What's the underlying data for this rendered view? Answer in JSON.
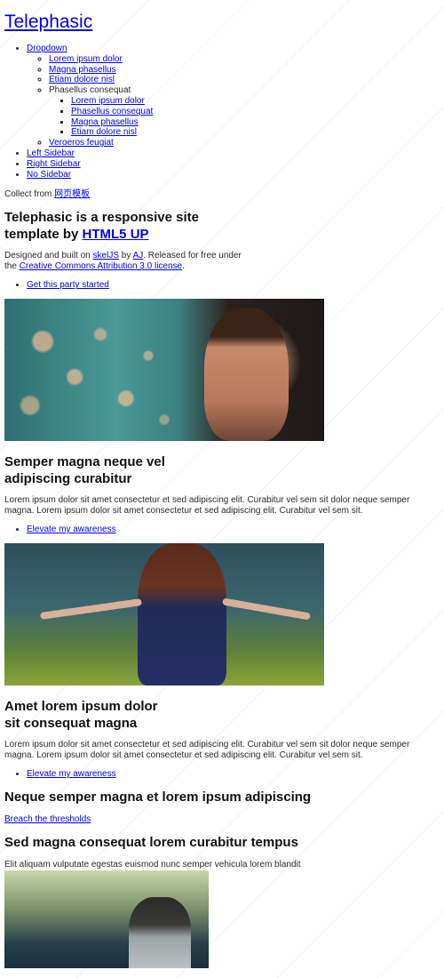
{
  "site": {
    "title": "Telephasic"
  },
  "nav": {
    "dropdown": {
      "label": "Dropdown",
      "items": [
        "Lorem ipsum dolor",
        "Magna phasellus",
        "Etiam dolore nisl"
      ],
      "submenu": {
        "label": "Phasellus consequat",
        "items": [
          "Lorem ipsum dolor",
          "Phasellus consequat",
          "Magna phasellus",
          "Etiam dolore nisl"
        ]
      },
      "last": "Veroeros feugiat"
    },
    "items": [
      "Left Sidebar",
      "Right Sidebar",
      "No Sidebar"
    ]
  },
  "collect": {
    "prefix": "Collect from ",
    "link": "网页模板"
  },
  "intro": {
    "heading": "Telephasic is a responsive site template by ",
    "heading_link": "HTML5 UP",
    "p1": "Designed and built on ",
    "p_link1": "skelJS",
    "p2": " by ",
    "p_link2": "AJ",
    "p3": ". Released for free under the ",
    "p_link3": "Creative Commons Attribution 3.0 license",
    "p4": ".",
    "action": "Get this party started"
  },
  "section1": {
    "heading": "Semper magna neque vel adipiscing curabitur",
    "text": "Lorem ipsum dolor sit amet consectetur et sed adipiscing elit. Curabitur vel sem sit dolor neque semper magna. Lorem ipsum dolor sit amet consectetur et sed adipiscing elit. Curabitur vel sem sit.",
    "action": "Elevate my awareness"
  },
  "section2": {
    "heading": "Amet lorem ipsum dolor sit consequat magna",
    "text": "Lorem ipsum dolor sit amet consectetur et sed adipiscing elit. Curabitur vel sem sit dolor neque semper magna. Lorem ipsum dolor sit amet consectetur et sed adipiscing elit. Curabitur vel sem sit.",
    "action": "Elevate my awareness"
  },
  "section3": {
    "heading": "Neque semper magna et lorem ipsum adipiscing",
    "link": "Breach the thresholds"
  },
  "section4": {
    "heading": "Sed magna consequat lorem curabitur tempus",
    "text": "Elit aliquam vulputate egestas euismod nunc semper vehicula lorem blandit"
  },
  "watermark": "webmoban.net"
}
